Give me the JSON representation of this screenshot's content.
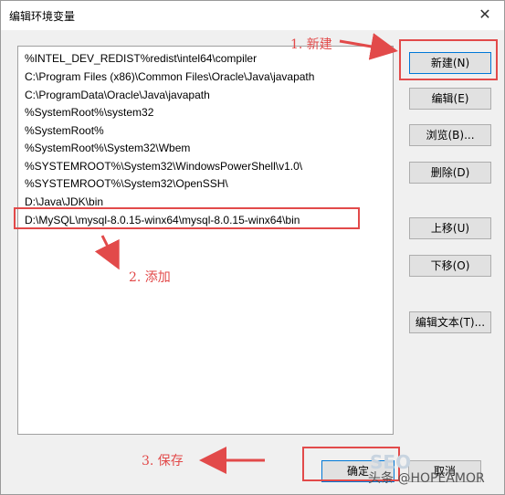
{
  "window": {
    "title": "编辑环境变量",
    "close_glyph": "✕"
  },
  "path_list": [
    "%INTEL_DEV_REDIST%redist\\intel64\\compiler",
    "C:\\Program Files (x86)\\Common Files\\Oracle\\Java\\javapath",
    "C:\\ProgramData\\Oracle\\Java\\javapath",
    "%SystemRoot%\\system32",
    "%SystemRoot%",
    "%SystemRoot%\\System32\\Wbem",
    "%SYSTEMROOT%\\System32\\WindowsPowerShell\\v1.0\\",
    "%SYSTEMROOT%\\System32\\OpenSSH\\",
    "D:\\Java\\JDK\\bin",
    "D:\\MySQL\\mysql-8.0.15-winx64\\mysql-8.0.15-winx64\\bin"
  ],
  "buttons": {
    "new": "新建(N)",
    "edit": "编辑(E)",
    "browse": "浏览(B)...",
    "delete": "删除(D)",
    "move_up": "上移(U)",
    "move_down": "下移(O)",
    "edit_text": "编辑文本(T)...",
    "ok": "确定",
    "cancel": "取消"
  },
  "annotations": {
    "step1": "1. 新建",
    "step2": "2. 添加",
    "step3": "3. 保存"
  },
  "watermark": {
    "faded_text": "SEO",
    "source": "头条 @HOPEAMOR"
  },
  "colors": {
    "annotation_red": "#e24a4a",
    "accent_blue": "#0078d7"
  }
}
